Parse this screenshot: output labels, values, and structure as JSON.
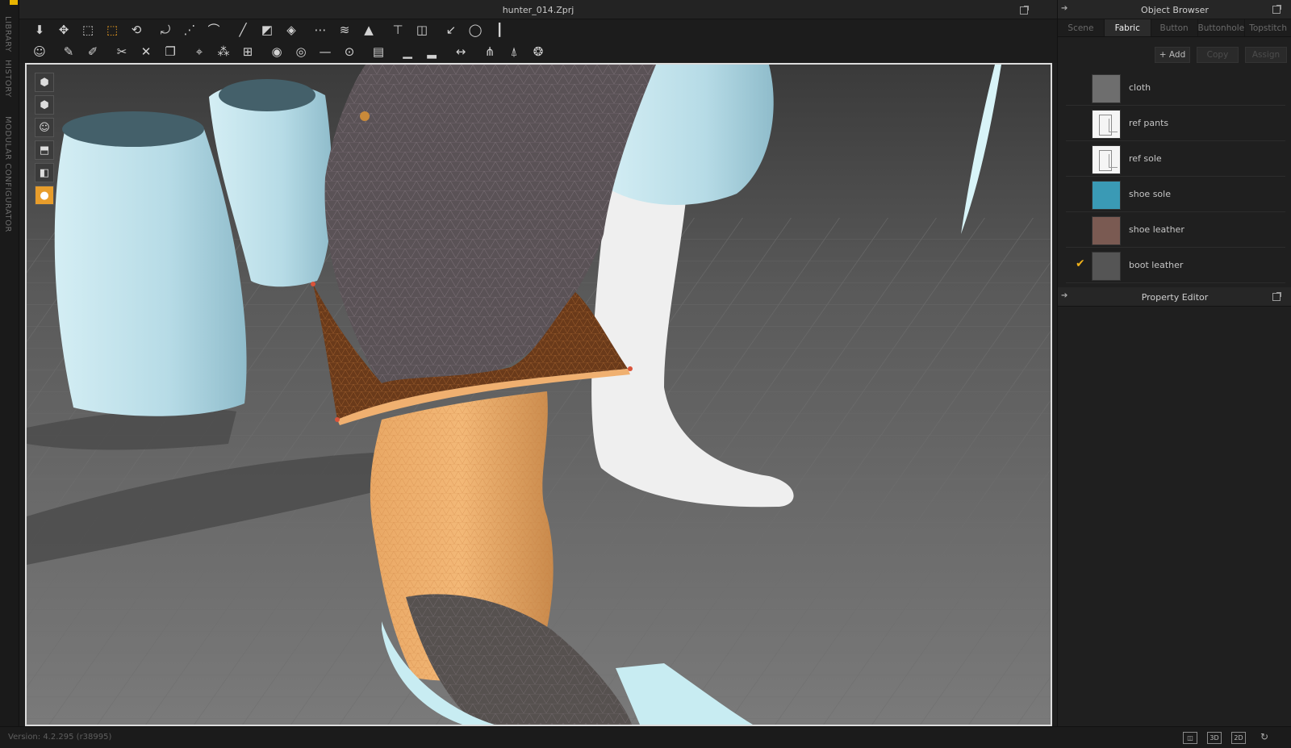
{
  "window": {
    "title": "hunter_014.Zprj"
  },
  "left_tabs": [
    "LIBRARY",
    "HISTORY",
    "MODULAR CONFIGURATOR"
  ],
  "toolbar_row1": [
    {
      "icon": "arrow-down-icon",
      "glyph": "⬇"
    },
    {
      "icon": "move-icon",
      "glyph": "✥"
    },
    {
      "icon": "select-box-icon",
      "glyph": "⬚"
    },
    {
      "icon": "transform-box-icon",
      "glyph": "⬚",
      "active": true
    },
    {
      "icon": "edit-pattern-icon",
      "glyph": "⟲"
    },
    {
      "sep": true
    },
    {
      "icon": "rotate-pattern-icon",
      "glyph": "⤾"
    },
    {
      "icon": "segment-icon",
      "glyph": "⋰"
    },
    {
      "icon": "curve-icon",
      "glyph": "⌒"
    },
    {
      "sep": true
    },
    {
      "icon": "line-icon",
      "glyph": "╱"
    },
    {
      "icon": "fold-icon",
      "glyph": "◩"
    },
    {
      "icon": "garment-icon",
      "glyph": "◈"
    },
    {
      "sep": true
    },
    {
      "icon": "sewing-icon",
      "glyph": "⋯"
    },
    {
      "icon": "stitch-icon",
      "glyph": "≋"
    },
    {
      "icon": "zipper-icon",
      "glyph": "▲"
    },
    {
      "sep": true
    },
    {
      "icon": "shirt-icon",
      "glyph": "⊤"
    },
    {
      "icon": "symmetry-icon",
      "glyph": "◫"
    },
    {
      "sep": true
    },
    {
      "icon": "tack-icon",
      "glyph": "↙"
    },
    {
      "icon": "lasso-icon",
      "glyph": "◯"
    },
    {
      "icon": "pin-icon",
      "glyph": "┃"
    }
  ],
  "toolbar_row2": [
    {
      "icon": "avatar-pose-icon",
      "glyph": "☺"
    },
    {
      "sep": true
    },
    {
      "icon": "needle-icon",
      "glyph": "✎"
    },
    {
      "icon": "pen-icon",
      "glyph": "✐"
    },
    {
      "sep": true
    },
    {
      "icon": "trim-icon",
      "glyph": "✂"
    },
    {
      "icon": "cut-icon",
      "glyph": "✕"
    },
    {
      "icon": "copy-icon",
      "glyph": "❐"
    },
    {
      "sep": true
    },
    {
      "icon": "measure-icon",
      "glyph": "⌖"
    },
    {
      "icon": "puckering-icon",
      "glyph": "⁂"
    },
    {
      "icon": "grid-icon",
      "glyph": "⊞"
    },
    {
      "sep": true
    },
    {
      "icon": "button-icon",
      "glyph": "◉"
    },
    {
      "icon": "circle-icon",
      "glyph": "◎"
    },
    {
      "icon": "topstitch-icon",
      "glyph": "—"
    },
    {
      "icon": "buttonhole-icon",
      "glyph": "⊙"
    },
    {
      "sep": true
    },
    {
      "icon": "zip-icon",
      "glyph": "▤"
    },
    {
      "sep": true
    },
    {
      "icon": "shoe-icon",
      "glyph": "▁"
    },
    {
      "icon": "sole-icon",
      "glyph": "▂"
    },
    {
      "sep": true
    },
    {
      "icon": "align-icon",
      "glyph": "↔"
    },
    {
      "sep": true
    },
    {
      "icon": "fit-icon",
      "glyph": "⋔"
    },
    {
      "icon": "dress-icon",
      "glyph": "⍋"
    },
    {
      "icon": "brain-icon",
      "glyph": "❂"
    }
  ],
  "viewport_tools": [
    {
      "icon": "show-garment-icon",
      "glyph": "⬢"
    },
    {
      "icon": "show-pattern-icon",
      "glyph": "⬢"
    },
    {
      "icon": "show-avatar-icon",
      "glyph": "☺"
    },
    {
      "icon": "show-pins-icon",
      "glyph": "⬒"
    },
    {
      "icon": "show-texture-icon",
      "glyph": "◧"
    },
    {
      "icon": "avatar-skin-icon",
      "glyph": "●",
      "active": true
    }
  ],
  "object_browser": {
    "title": "Object Browser",
    "tabs": [
      {
        "label": "Scene",
        "active": false
      },
      {
        "label": "Fabric",
        "active": true
      },
      {
        "label": "Button",
        "active": false
      },
      {
        "label": "Buttonhole",
        "active": false
      },
      {
        "label": "Topstitch",
        "active": false
      }
    ],
    "actions": {
      "add": "+ Add",
      "copy": "Copy",
      "assign": "Assign"
    },
    "fabrics": [
      {
        "name": "cloth",
        "color": "#6e6e6e",
        "swatch": "solid",
        "checked": false
      },
      {
        "name": "ref pants",
        "color": "#f5f5f5",
        "swatch": "sketch",
        "checked": false
      },
      {
        "name": "ref sole",
        "color": "#f5f5f5",
        "swatch": "sketch",
        "checked": false
      },
      {
        "name": "shoe sole",
        "color": "#3a9ab5",
        "swatch": "solid",
        "checked": false
      },
      {
        "name": "shoe leather",
        "color": "#7a5a52",
        "swatch": "solid",
        "checked": false
      },
      {
        "name": "boot leather",
        "color": "#555555",
        "swatch": "solid",
        "checked": true
      }
    ]
  },
  "property_editor": {
    "title": "Property Editor"
  },
  "status": {
    "version": "Version: 4.2.295 (r38995)"
  },
  "view_modes": [
    "3D",
    "2D"
  ],
  "colors": {
    "accent": "#f0a020",
    "checkmark": "#f0b11a",
    "garment_light_blue": "#bfe3ec",
    "boot_orange": "#e8a160",
    "avatar_skin": "#efefef",
    "pants_mesh": "#5a5256"
  }
}
